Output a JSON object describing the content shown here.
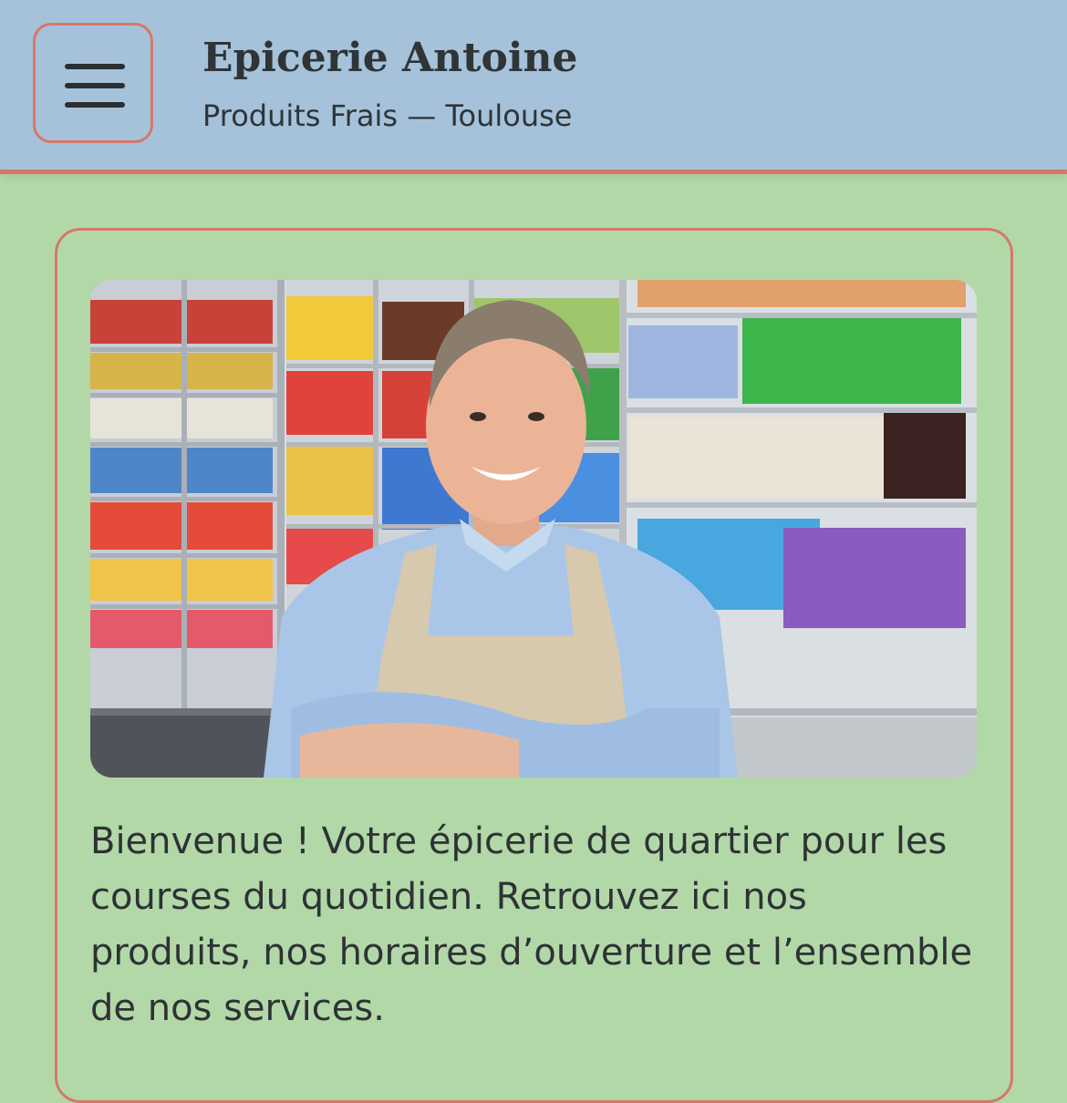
{
  "header": {
    "menu_icon": "hamburger-menu-icon",
    "title": "Epicerie Antoine",
    "subtitle": "Produits Frais — Toulouse"
  },
  "main": {
    "hero_image": "grocer-portrait-photo",
    "welcome_text": "Bienvenue ! Votre épicerie de quartier pour les courses du quotidien. Retrouvez ici nos produits, nos horaires d’ouverture et l’ensemble de nos services."
  },
  "colors": {
    "header_bg": "#a5c2da",
    "page_bg": "#b2d8a8",
    "accent_border": "#d7776a",
    "text": "#2f3437"
  }
}
